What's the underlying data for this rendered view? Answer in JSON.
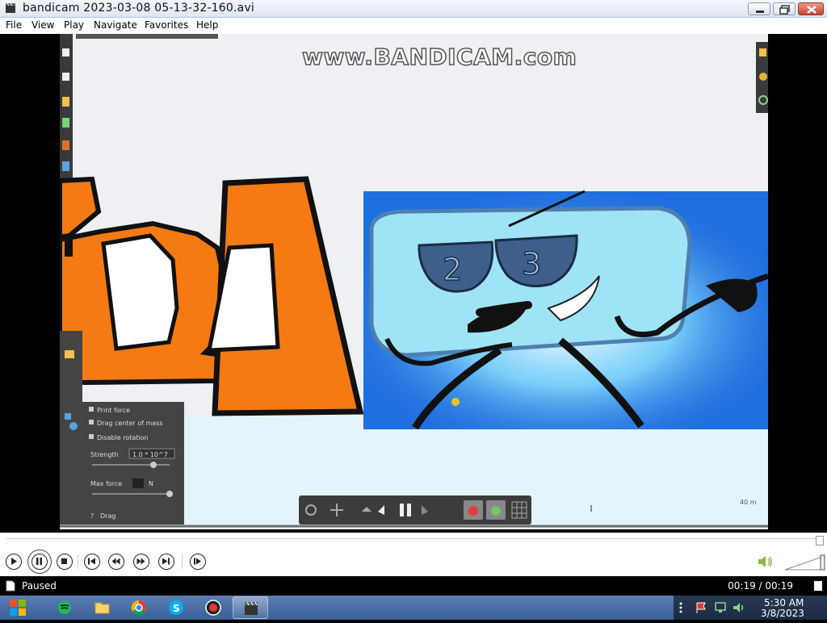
{
  "window": {
    "title": "bandicam 2023-03-08 05-13-32-160.avi"
  },
  "menu": {
    "items": [
      "File",
      "View",
      "Play",
      "Navigate",
      "Favorites",
      "Help"
    ]
  },
  "video": {
    "watermark": "www.BANDICAM.com",
    "sunglasses_left_digit": "2",
    "sunglasses_right_digit": "3",
    "overlay_panel": {
      "options": [
        "Print force",
        "Drag center of mass",
        "Disable rotation"
      ],
      "strength_label": "Strength",
      "strength_value": "1.0 * 10^7",
      "max_force_label": "Max force",
      "max_force_value": "N",
      "drag_label": "Drag"
    },
    "scale_label": "40 m"
  },
  "controls": {
    "icons": [
      "play-icon",
      "pause-icon",
      "stop-icon",
      "previous-icon",
      "rewind-icon",
      "fast-forward-icon",
      "next-icon",
      "frame-step-icon"
    ]
  },
  "status": {
    "state": "Paused",
    "time": "00:19 / 00:19"
  },
  "taskbar": {
    "clock_time": "5:30 AM",
    "clock_date": "3/8/2023"
  }
}
